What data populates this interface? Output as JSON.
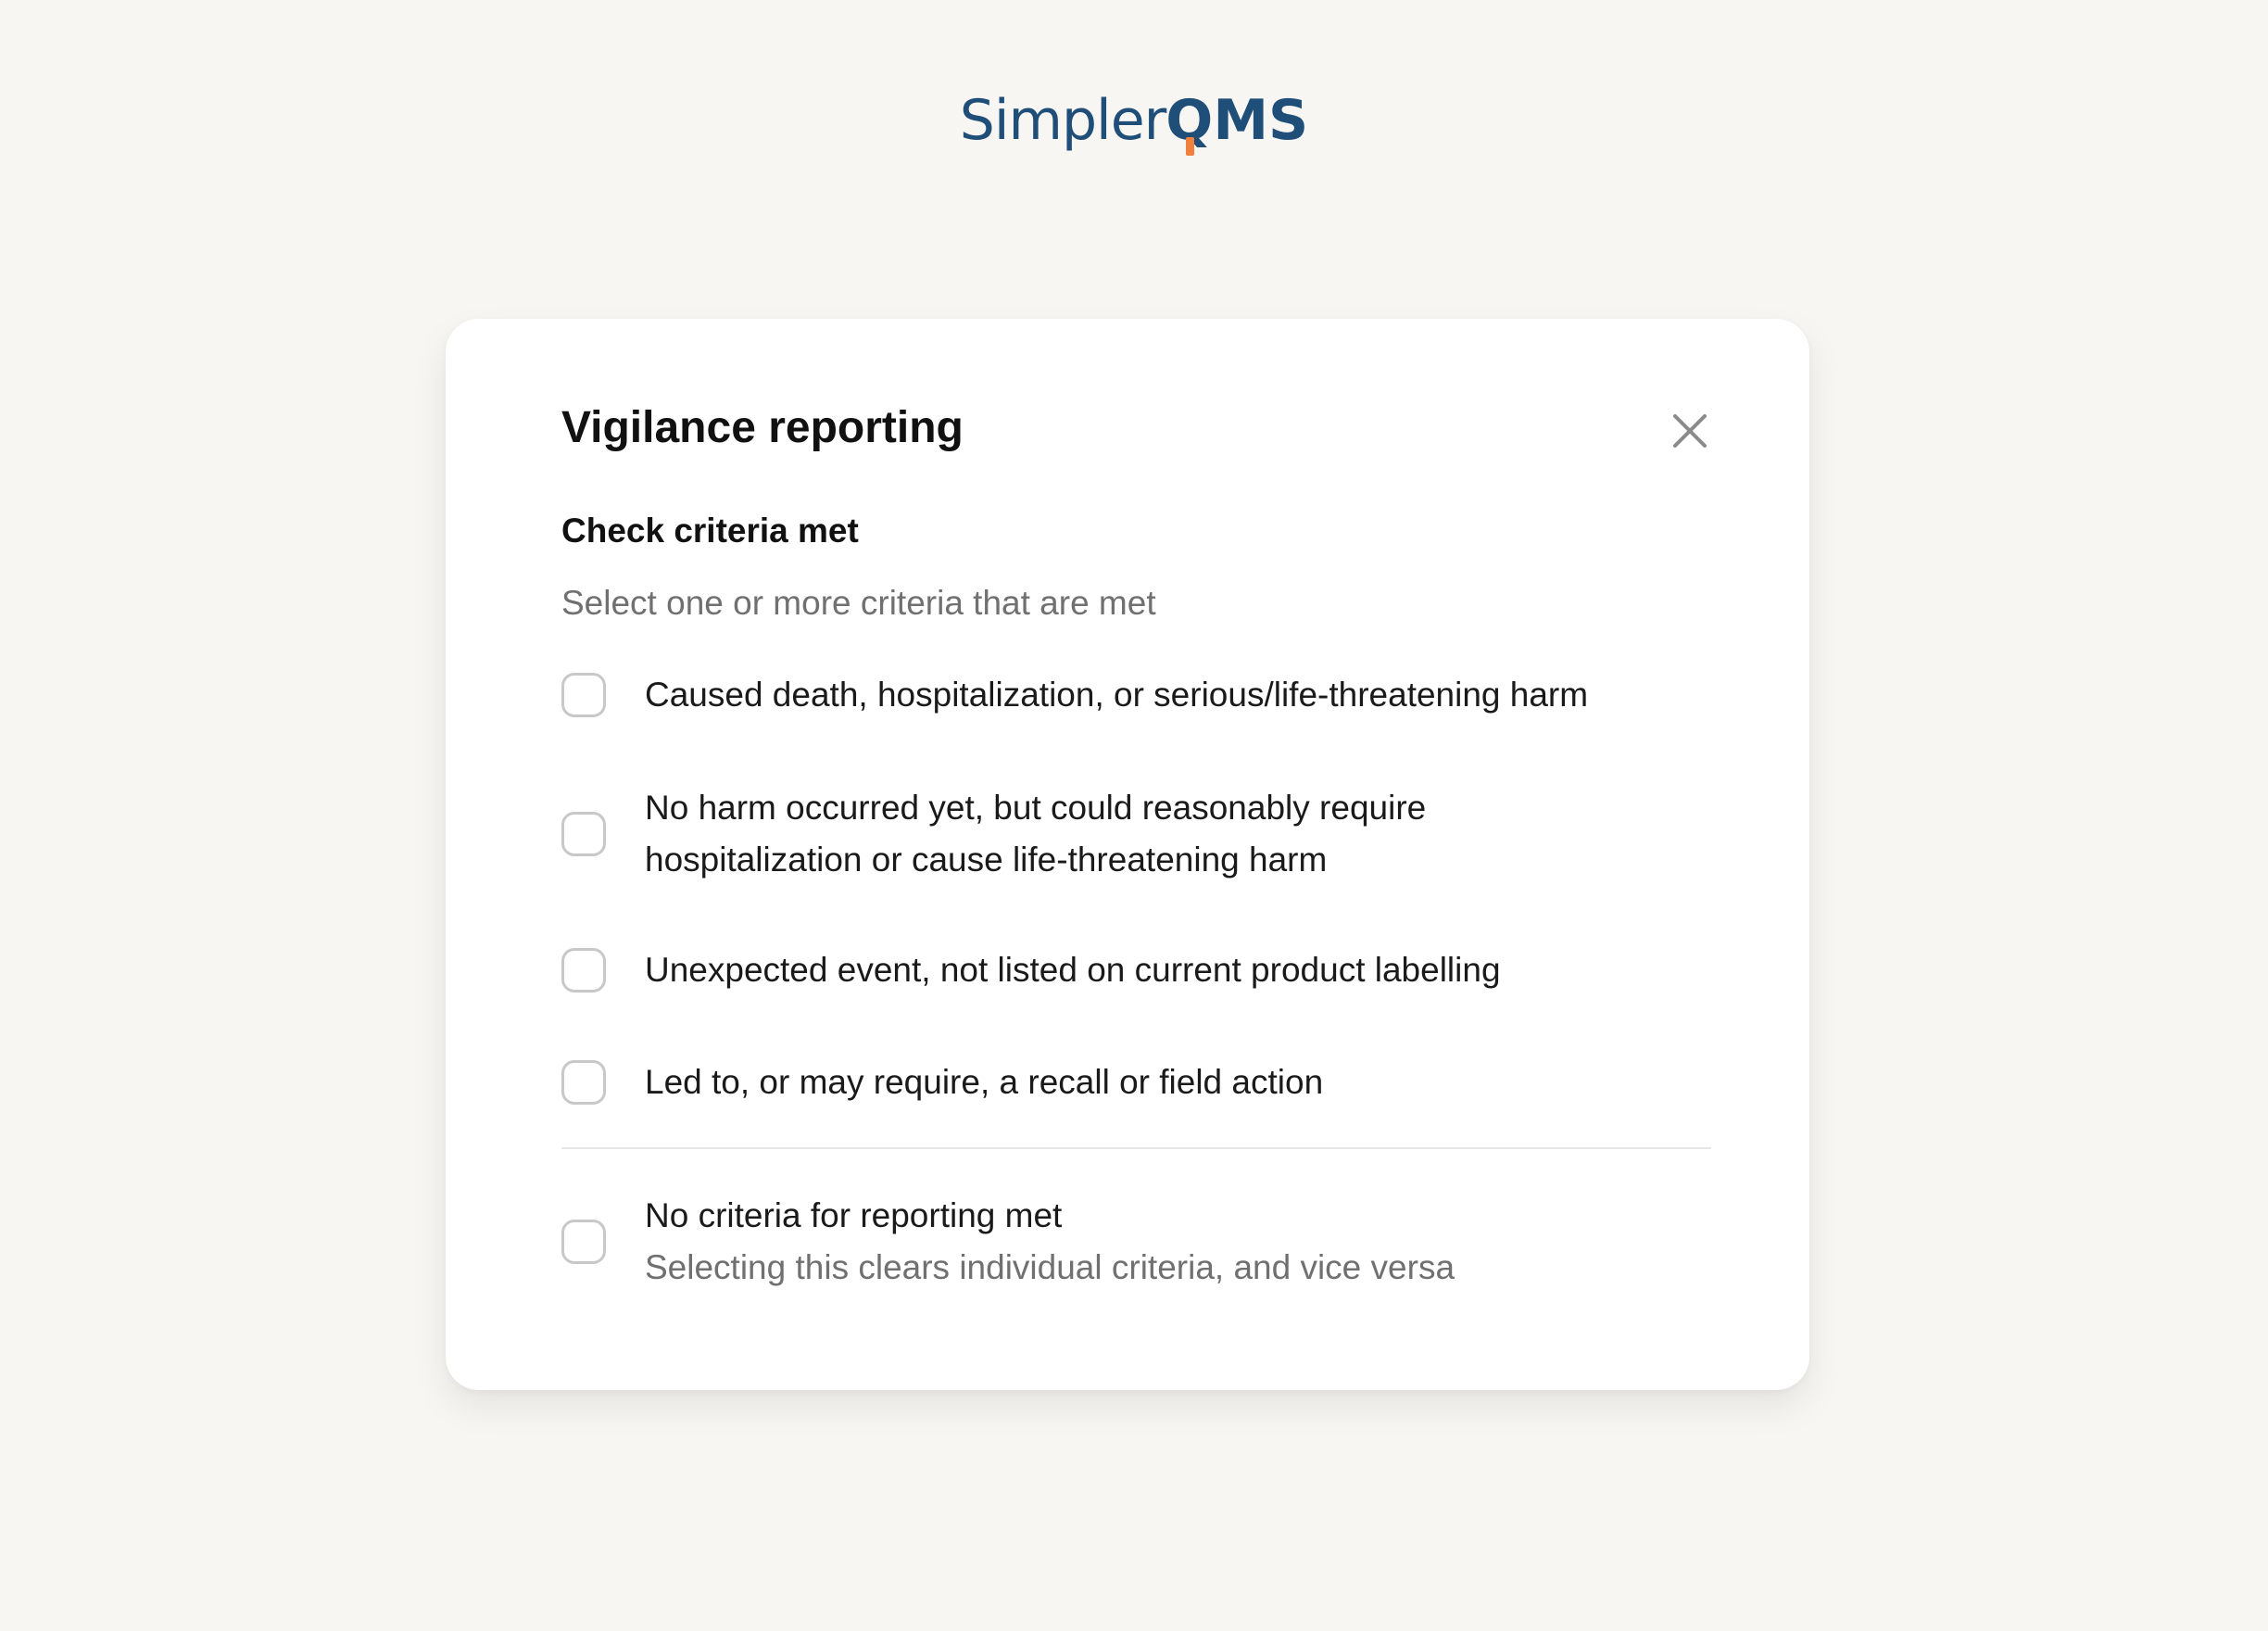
{
  "logo": {
    "simpler": "Simpler",
    "q": "Q",
    "ms": "MS",
    "colors": {
      "primary": "#1f4e79",
      "accent": "#f0803c"
    }
  },
  "dialog": {
    "title": "Vigilance reporting",
    "close_icon": "close-icon",
    "section_title": "Check criteria met",
    "section_subtitle": "Select one or more criteria that are met",
    "options": [
      {
        "label": "Caused death, hospitalization, or serious/life-threatening harm",
        "checked": false
      },
      {
        "label_line1": "No harm occurred yet, but could reasonably require",
        "label_line2": "hospitalization or cause life-threatening harm",
        "checked": false
      },
      {
        "label": "Unexpected event, not listed on current product labelling",
        "checked": false
      },
      {
        "label": "Led to, or may require, a recall or field action",
        "checked": false
      }
    ],
    "none_option": {
      "label": "No criteria for reporting met",
      "sublabel": "Selecting this clears individual criteria, and vice versa",
      "checked": false
    }
  }
}
